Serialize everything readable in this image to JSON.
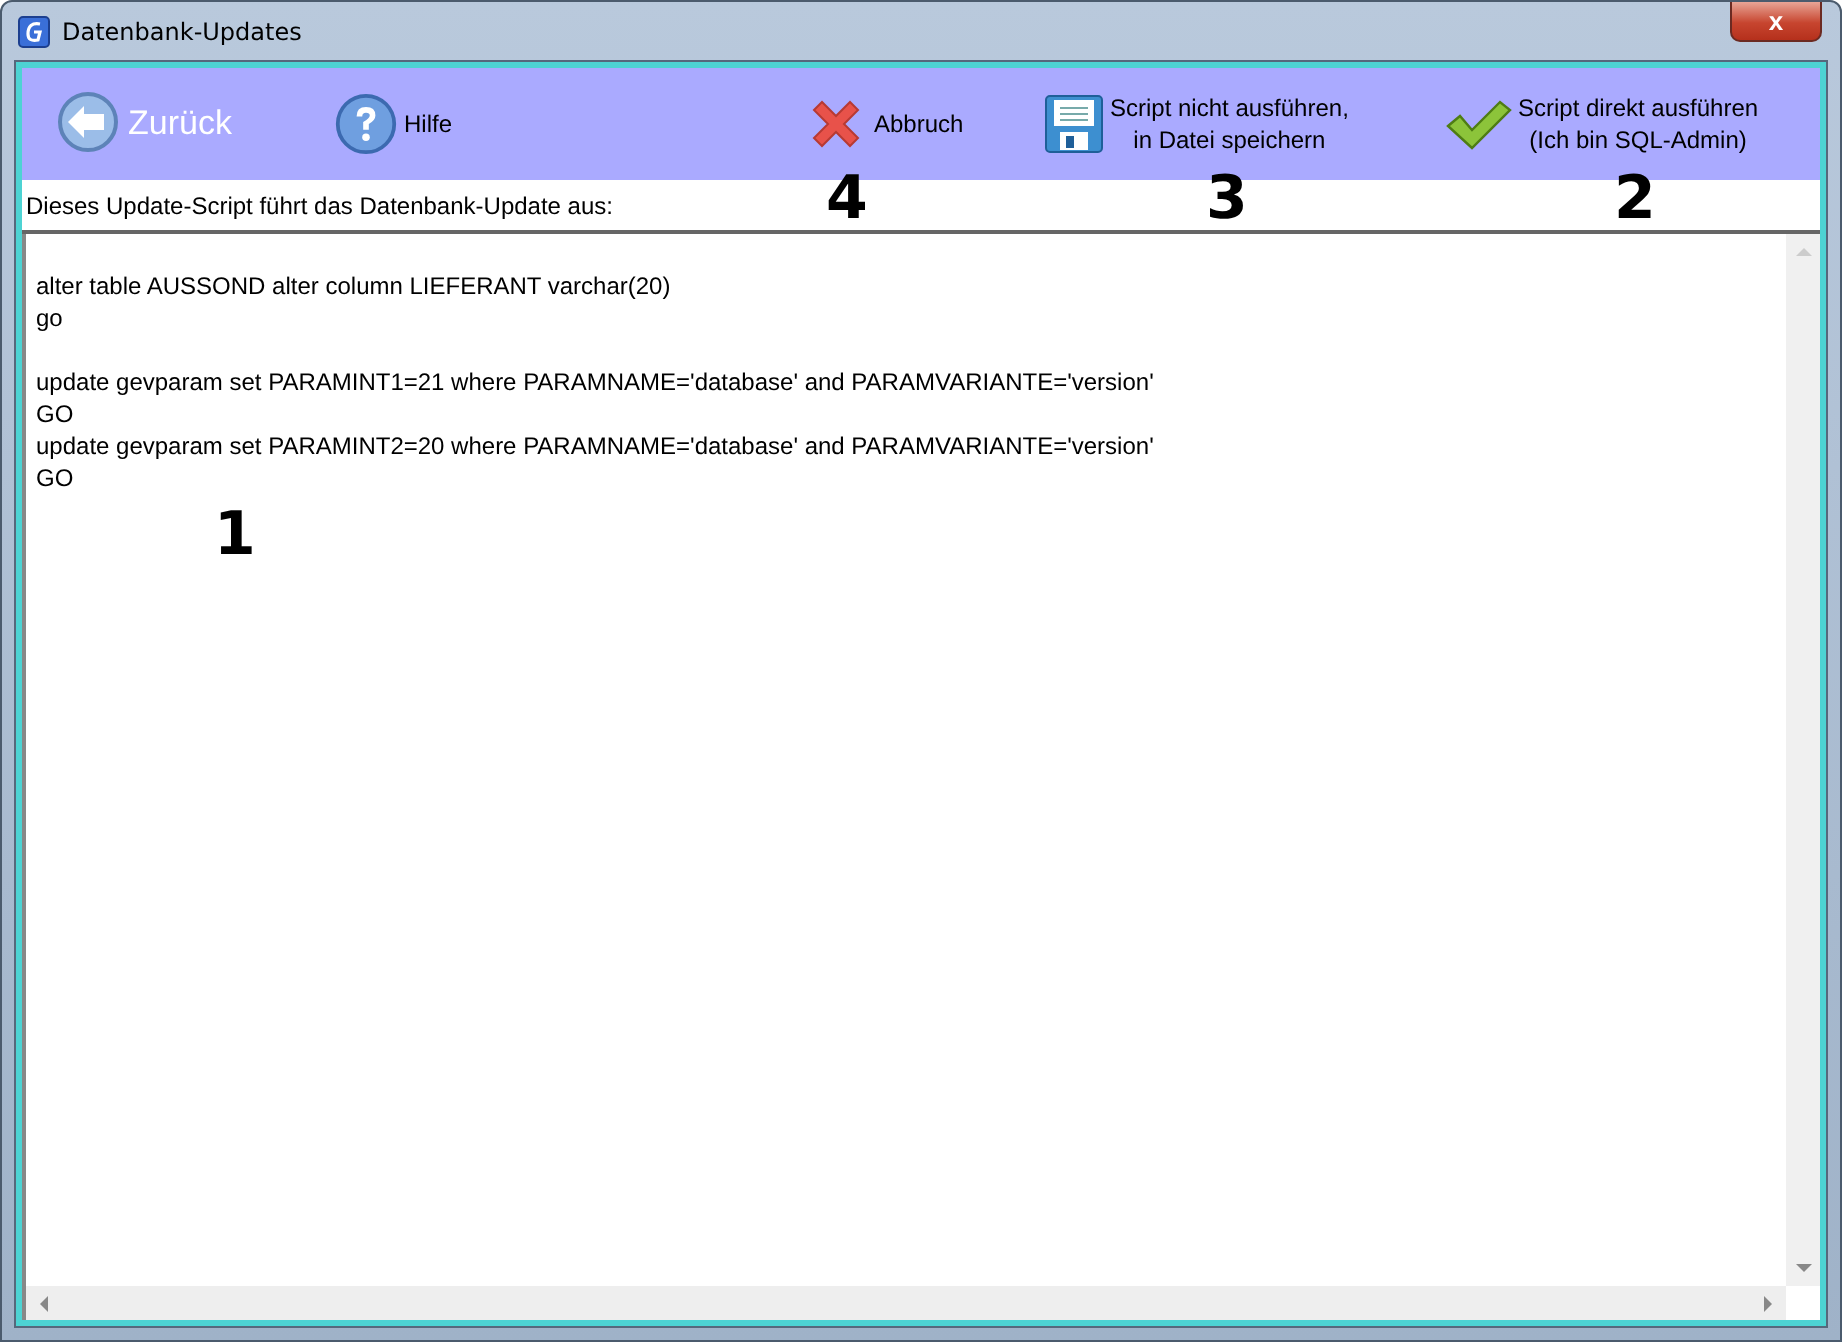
{
  "window": {
    "title": "Datenbank-Updates",
    "close": "x"
  },
  "toolbar": [
    {
      "kind": "back",
      "label": "Zurück",
      "disabled": true
    },
    {
      "kind": "help",
      "label": "Hilfe",
      "disabled": false
    },
    {
      "kind": "cancel",
      "label": "Abbruch",
      "disabled": false
    },
    {
      "kind": "save",
      "label": "Script nicht ausführen,\nin Datei speichern",
      "disabled": false
    },
    {
      "kind": "run",
      "label": "Script direkt ausführen\n(Ich bin SQL-Admin)",
      "disabled": false
    }
  ],
  "caption": "Dieses Update-Script führt das Datenbank-Update aus:",
  "script_blocks": [
    [
      "alter table AUSSOND alter column LIEFERANT varchar(20)",
      "go"
    ],
    [
      "update gevparam set PARAMINT1=21 where PARAMNAME='database' and PARAMVARIANTE='version'",
      "GO",
      "update gevparam set PARAMINT2=20 where PARAMNAME='database' and PARAMVARIANTE='version'",
      "GO"
    ]
  ],
  "annotations": [
    {
      "label": "4",
      "kind": "caption"
    },
    {
      "label": "3",
      "kind": "caption"
    },
    {
      "label": "2",
      "kind": "caption"
    },
    {
      "label": "1",
      "kind": "script"
    }
  ]
}
